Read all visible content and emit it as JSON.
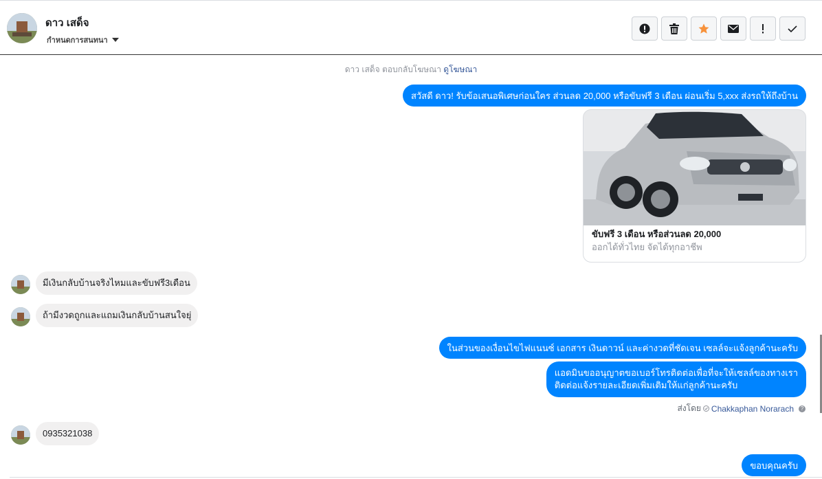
{
  "header": {
    "name": "ดาว เสด็จ",
    "stage_label": "กำหนดการสนทนา",
    "toolbar": [
      {
        "icon": "alert-circle-icon",
        "label": "spam"
      },
      {
        "icon": "trash-icon",
        "label": "delete"
      },
      {
        "icon": "star-icon",
        "label": "star"
      },
      {
        "icon": "envelope-icon",
        "label": "mark unread"
      },
      {
        "icon": "exclamation-icon",
        "label": "follow up"
      },
      {
        "icon": "check-icon",
        "label": "done"
      }
    ],
    "star_color": "#f7923b"
  },
  "thread": {
    "ad_notice_prefix": "ดาว เสด็จ ตอบกลับโฆษณา",
    "ad_notice_link": "ดูโฆษณา",
    "messages": [
      {
        "from": "page",
        "text": "สวัสดี ดาว! รับข้อเสนอพิเศษก่อนใคร ส่วนลด 20,000 หรือขับฟรี 3 เดือน ผ่อนเริ่ม 5,xxx ส่งรถให้ถึงบ้าน"
      },
      {
        "from": "user",
        "text": "มีเงินกลับบ้านจริงไหมและขับฟรี3เดือน"
      },
      {
        "from": "user",
        "text": "ถ้ามีงวดถูกและแถมเงินกลับบ้านสนใจยุ่"
      },
      {
        "from": "page",
        "text": "ในส่วนของเงื่อนไขไฟแนนซ์ เอกสาร เงินดาวน์ และค่างวดที่ชัดเจน เซลล์จะแจ้งลูกค้านะครับ"
      },
      {
        "from": "page",
        "text_line1": "แอดมินขออนุญาตขอเบอร์โทรติดต่อเพื่อที่จะให้เซลล์ของทางเรา",
        "text_line2": "ติดต่อแจ้งรายละเอียดเพิ่มเติมให้แก่ลูกค้านะครับ"
      },
      {
        "from": "user",
        "text": "0935321038"
      },
      {
        "from": "page",
        "text": "ขอบคุณครับ"
      }
    ],
    "ad_card": {
      "title": "ขับฟรี 3 เดือน หรือส่วนลด 20,000",
      "subtitle": "ออกได้ทั่วไทย จัดได้ทุกอาชีพ"
    },
    "sent_by_label": "ส่งโดย",
    "sent_by_name": "Chakkaphan Norarach",
    "accent_color": "#0084ff"
  }
}
